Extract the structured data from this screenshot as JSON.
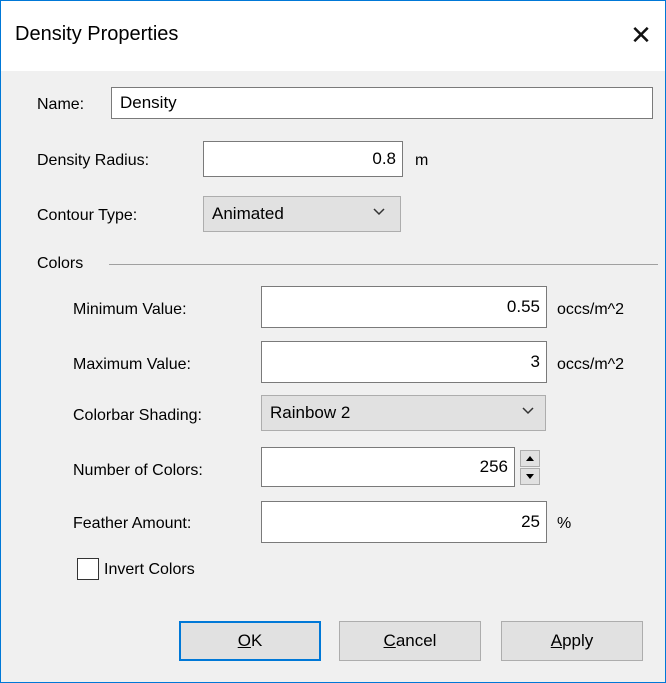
{
  "window": {
    "title": "Density Properties",
    "close_glyph": "✕"
  },
  "name": {
    "label": "Name:",
    "value": "Density"
  },
  "density_radius": {
    "label": "Density Radius:",
    "value": "0.8",
    "unit": "m"
  },
  "contour_type": {
    "label": "Contour Type:",
    "value": "Animated"
  },
  "colors": {
    "section_label": "Colors",
    "minimum_value": {
      "label": "Minimum Value:",
      "value": "0.55",
      "unit": "occs/m^2"
    },
    "maximum_value": {
      "label": "Maximum Value:",
      "value": "3",
      "unit": "occs/m^2"
    },
    "colorbar_shading": {
      "label": "Colorbar Shading:",
      "value": "Rainbow 2"
    },
    "number_of_colors": {
      "label": "Number of Colors:",
      "value": "256"
    },
    "feather_amount": {
      "label": "Feather Amount:",
      "value": "25",
      "unit": "%"
    },
    "invert_colors": {
      "label": "Invert Colors",
      "checked": false
    }
  },
  "buttons": {
    "ok": {
      "mnemonic": "O",
      "rest": "K"
    },
    "cancel": {
      "mnemonic": "C",
      "rest": "ancel"
    },
    "apply": {
      "mnemonic": "A",
      "rest": "pply"
    }
  },
  "colors_theme": {
    "accent": "#0078d7",
    "dialog_bg": "#f0f0f0",
    "button_bg": "#e1e1e1"
  }
}
